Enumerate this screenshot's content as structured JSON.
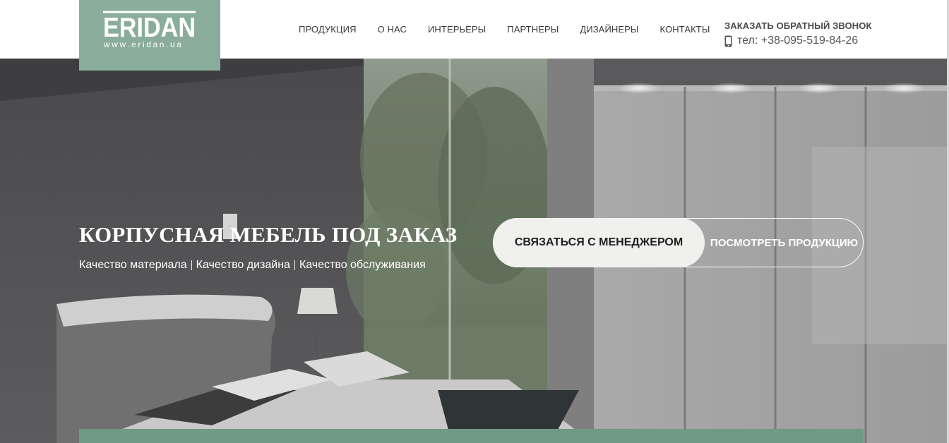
{
  "brand": {
    "logo_text": "ERIDAN",
    "logo_url_text": "www.eridan.ua",
    "logo_bg": "#8aad9b"
  },
  "nav": {
    "items": [
      {
        "label": "ПРОДУКЦИЯ"
      },
      {
        "label": "О НАС"
      },
      {
        "label": "ИНТЕРЬЕРЫ"
      },
      {
        "label": "ПАРТНЕРЫ"
      },
      {
        "label": "ДИЗАЙНЕРЫ"
      },
      {
        "label": "КОНТАКТЫ"
      }
    ]
  },
  "contact": {
    "callback_label": "ЗАКАЗАТЬ ОБРАТНЫЙ ЗВОНОК",
    "phone_icon": "mobile-phone-icon",
    "phone": "тел: +38-095-519-84-26"
  },
  "hero": {
    "title": "КОРПУСНАЯ МЕБЕЛЬ ПОД ЗАКАЗ",
    "features": [
      "Качество материала",
      "Качество дизайна",
      "Качество обслуживания"
    ],
    "primary_button": "СВЯЗАТЬСЯ С МЕНЕДЖЕРОМ",
    "secondary_button": "ПОСМОТРЕТЬ ПРОДУКЦИЮ",
    "accent_color": "#6e9a86"
  }
}
